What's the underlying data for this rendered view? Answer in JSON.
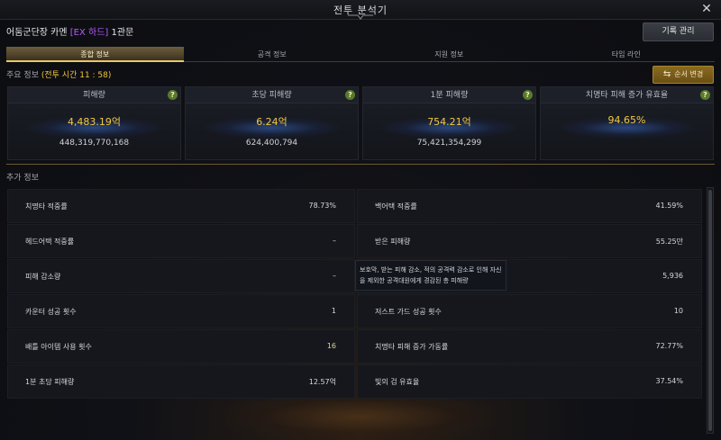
{
  "window": {
    "title": "전투 분석기",
    "close_label": "✕"
  },
  "header": {
    "raid_name": "어둠군단장 카멘",
    "difficulty": "[EX 하드]",
    "gate": "1관문",
    "record_button": "기록 관리"
  },
  "tabs": [
    {
      "label": "종합 정보",
      "active": true
    },
    {
      "label": "공격 정보",
      "active": false
    },
    {
      "label": "지원 정보",
      "active": false
    },
    {
      "label": "타임 라인",
      "active": false
    }
  ],
  "summary": {
    "label": "주요 정보",
    "combat_time": "(전투 시간 11 : 58)",
    "order_button": "순서 변경",
    "cards": [
      {
        "title": "피해량",
        "value": "4,483.19억",
        "sub": "448,319,770,168",
        "help": "?"
      },
      {
        "title": "초당 피해량",
        "value": "6.24억",
        "sub": "624,400,794",
        "help": "?"
      },
      {
        "title": "1분 피해량",
        "value": "754.21억",
        "sub": "75,421,354,299",
        "help": "?"
      },
      {
        "title": "치명타 피해 증가 유효율",
        "value": "94.65%",
        "sub": "",
        "help": "?"
      }
    ]
  },
  "extra": {
    "label": "추가 정보",
    "rows": [
      {
        "label": "치명타 적중률",
        "value": "78.73%"
      },
      {
        "label": "백어택 적중률",
        "value": "41.59%"
      },
      {
        "label": "헤드어택 적중률",
        "value": "–"
      },
      {
        "label": "받은 피해량",
        "value": "55.25만"
      },
      {
        "label": "피해 감소량",
        "value": "–"
      },
      {
        "label": "",
        "value": "5,936"
      },
      {
        "label": "카운터 성공 횟수",
        "value": "1"
      },
      {
        "label": "저스트 가드 성공 횟수",
        "value": "10"
      },
      {
        "label": "배틀 아이템 사용 횟수",
        "value": "16"
      },
      {
        "label": "치명타 피해 증가 가동률",
        "value": "72.77%"
      },
      {
        "label": "1분 초당 피해량",
        "value": "12.57억"
      },
      {
        "label": "빛의 검 유효율",
        "value": "37.54%"
      }
    ],
    "tooltip": "보호막, 받는 피해 감소, 적의 공격력 감소로 인해 자신을 제외한 공격대원에게 경감된 총 피해량"
  },
  "colors": {
    "accent_gold": "#f2c93b",
    "difficulty_purple": "#b55cff",
    "help_green": "#5a7a2a"
  }
}
